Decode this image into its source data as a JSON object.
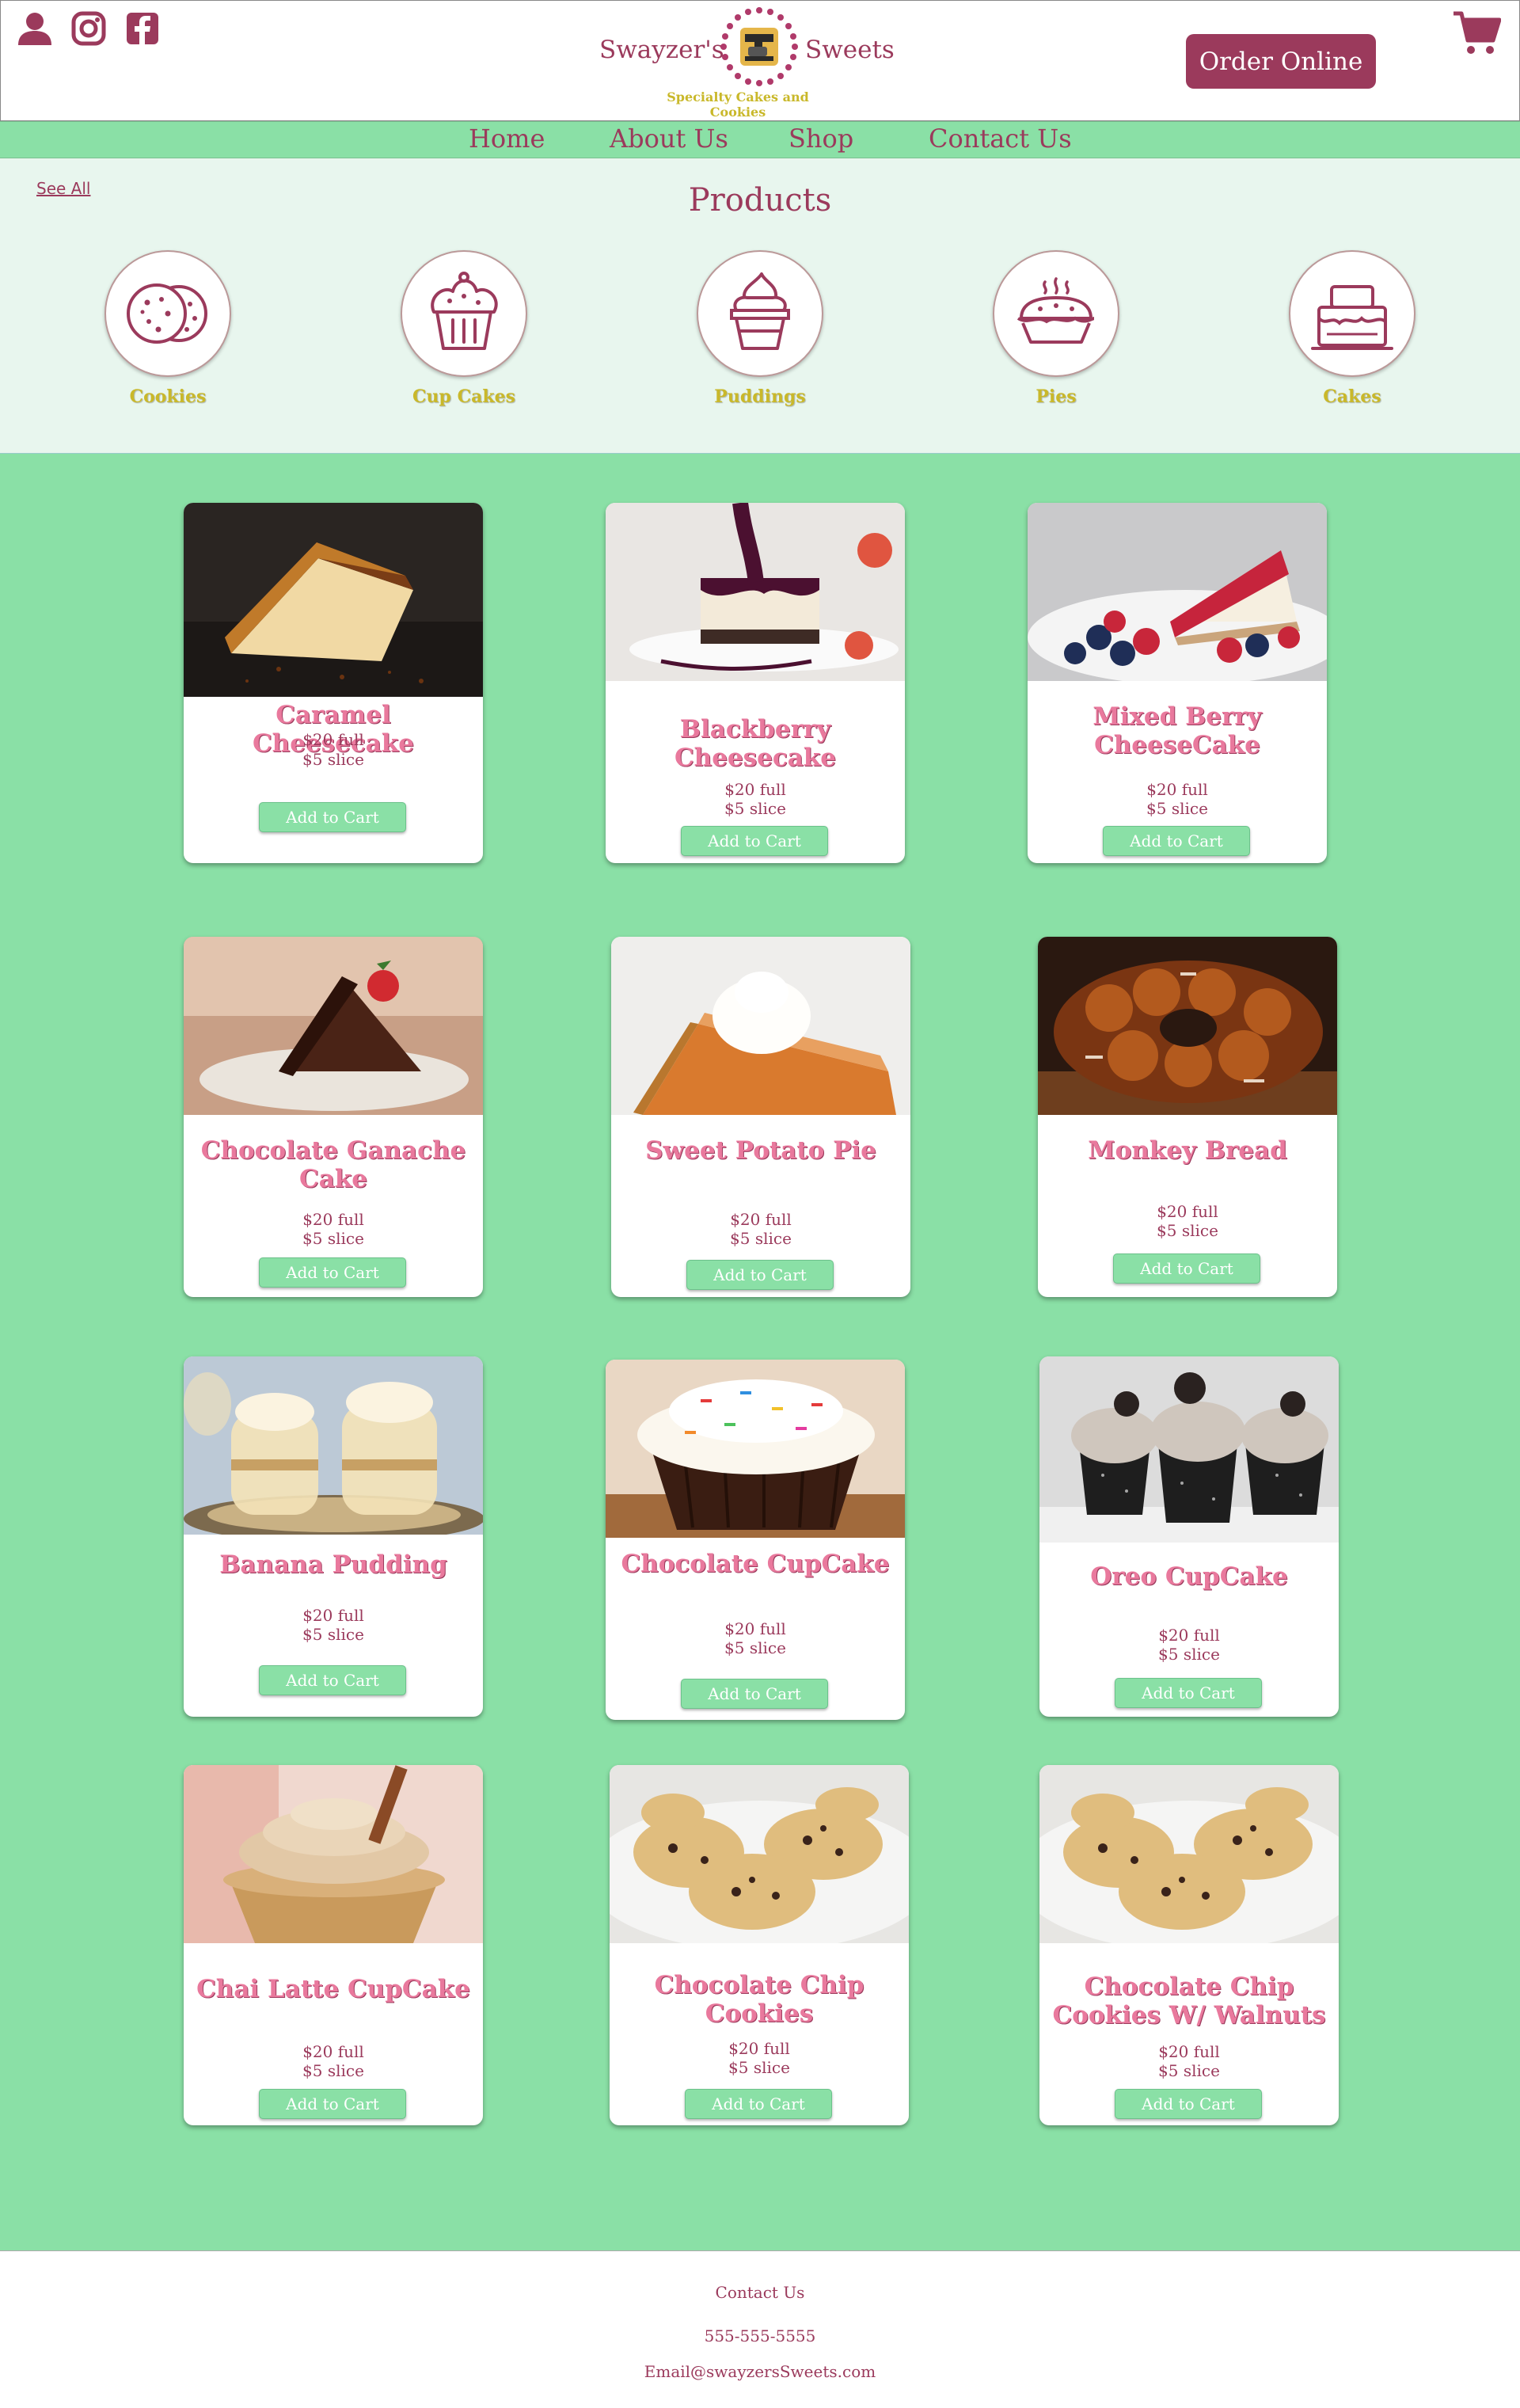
{
  "header": {
    "brand_left": "Swayzer's",
    "brand_right": "Sweets",
    "tagline": "Specialty Cakes and Cookies",
    "order_button": "Order Online",
    "icons": [
      "user-icon",
      "instagram-icon",
      "facebook-icon",
      "cart-icon"
    ]
  },
  "nav": {
    "items": [
      {
        "label": "Home"
      },
      {
        "label": "About Us"
      },
      {
        "label": "Shop"
      },
      {
        "label": "Contact Us"
      }
    ]
  },
  "categories": {
    "see_all": "See All",
    "title": "Products",
    "items": [
      {
        "label": "Cookies",
        "icon": "cookies-icon"
      },
      {
        "label": "Cup Cakes",
        "icon": "cupcake-icon"
      },
      {
        "label": "Puddings",
        "icon": "pudding-icon"
      },
      {
        "label": "Pies",
        "icon": "pie-icon"
      },
      {
        "label": "Cakes",
        "icon": "cake-icon"
      }
    ]
  },
  "products": [
    {
      "name": "Caramel Cheesecake",
      "full": "$20 full",
      "slice": "$5 slice",
      "button": "Add to Cart"
    },
    {
      "name": "Blackberry Cheesecake",
      "full": "$20 full",
      "slice": "$5 slice",
      "button": "Add to Cart"
    },
    {
      "name": "Mixed Berry CheeseCake",
      "full": "$20 full",
      "slice": "$5 slice",
      "button": "Add to Cart"
    },
    {
      "name": "Chocolate Ganache Cake",
      "full": "$20 full",
      "slice": "$5 slice",
      "button": "Add to Cart"
    },
    {
      "name": "Sweet Potato Pie",
      "full": "$20 full",
      "slice": "$5 slice",
      "button": "Add to Cart"
    },
    {
      "name": "Monkey Bread",
      "full": "$20 full",
      "slice": "$5 slice",
      "button": "Add to Cart"
    },
    {
      "name": "Banana Pudding",
      "full": "$20 full",
      "slice": "$5 slice",
      "button": "Add to Cart"
    },
    {
      "name": "Chocolate CupCake",
      "full": "$20 full",
      "slice": "$5 slice",
      "button": "Add to Cart"
    },
    {
      "name": "Oreo CupCake",
      "full": "$20 full",
      "slice": "$5 slice",
      "button": "Add to Cart"
    },
    {
      "name": "Chai Latte CupCake",
      "full": "$20 full",
      "slice": "$5 slice",
      "button": "Add to Cart"
    },
    {
      "name": "Chocolate Chip Cookies",
      "full": "$20 full",
      "slice": "$5 slice",
      "button": "Add to Cart"
    },
    {
      "name": "Chocolate Chip Cookies W/ Walnuts",
      "full": "$20 full",
      "slice": "$5 slice",
      "button": "Add to Cart"
    }
  ],
  "footer": {
    "contact": "Contact Us",
    "phone": "555-555-5555",
    "email": "Email@swayzersSweets.com"
  },
  "colors": {
    "brand": "#9b3a5c",
    "accent_green": "#8ae0a6",
    "gold": "#c9b82a",
    "product_name": "#e9799d"
  }
}
